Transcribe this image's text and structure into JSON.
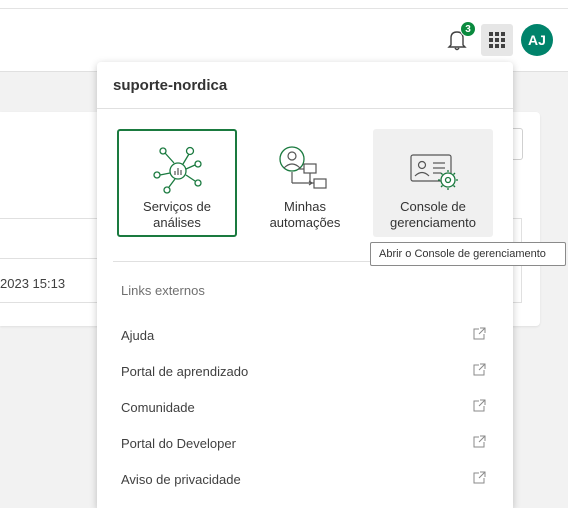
{
  "header": {
    "notifications_count": "3",
    "avatar_initials": "AJ"
  },
  "background": {
    "row_date": "2023 15:13"
  },
  "panel": {
    "tenant_name": "suporte-nordica",
    "tiles": [
      {
        "label_line1": "Serviços de",
        "label_line2": "análises",
        "icon": "analytics-services-icon",
        "selected": true
      },
      {
        "label_line1": "Minhas",
        "label_line2": "automações",
        "icon": "automations-icon",
        "selected": false
      },
      {
        "label_line1": "Console de",
        "label_line2": "gerenciamento",
        "icon": "management-console-icon",
        "selected": false,
        "hovered": true
      }
    ],
    "external_links_heading": "Links externos",
    "links": [
      {
        "label": "Ajuda"
      },
      {
        "label": "Portal de aprendizado"
      },
      {
        "label": "Comunidade"
      },
      {
        "label": "Portal do Developer"
      },
      {
        "label": "Aviso de privacidade"
      }
    ]
  },
  "tooltip": {
    "text": "Abrir o Console de gerenciamento"
  },
  "colors": {
    "accent_green": "#1a7a3f",
    "badge_green": "#0a8a3e",
    "avatar_teal": "#00836b"
  }
}
